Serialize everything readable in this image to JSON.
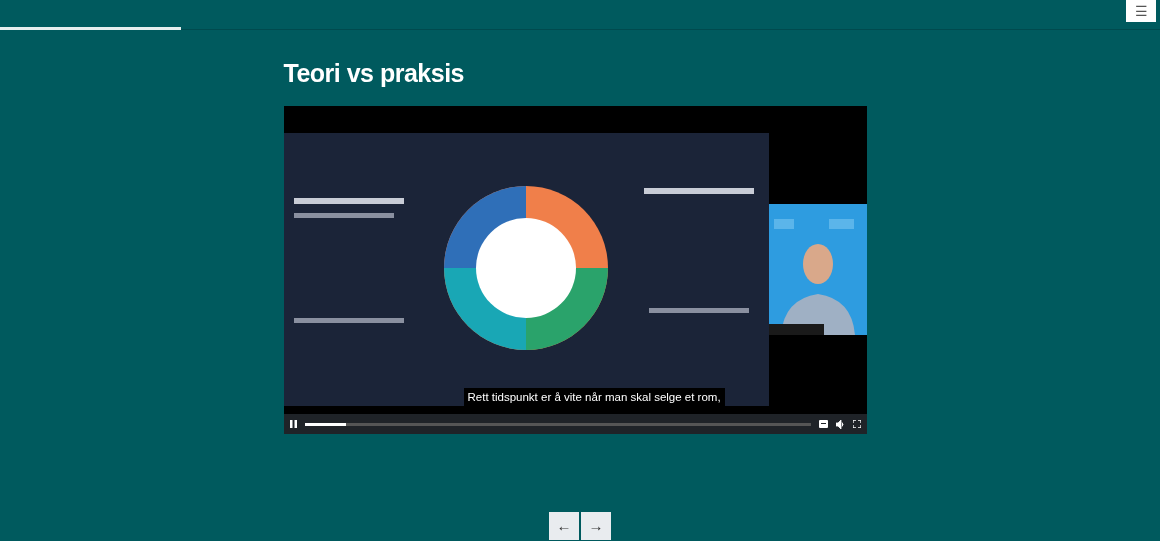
{
  "lesson_progress": {
    "level": 0.156
  },
  "menu_button": {
    "label": "☰"
  },
  "title": "Teori vs praksis",
  "video": {
    "caption": "Rett tidspunkt er å vite når man skal selge et rom,",
    "playing": true,
    "level": 0.083,
    "captions_on": true
  },
  "navigation": [
    {
      "label": "←"
    },
    {
      "label": "→"
    }
  ]
}
